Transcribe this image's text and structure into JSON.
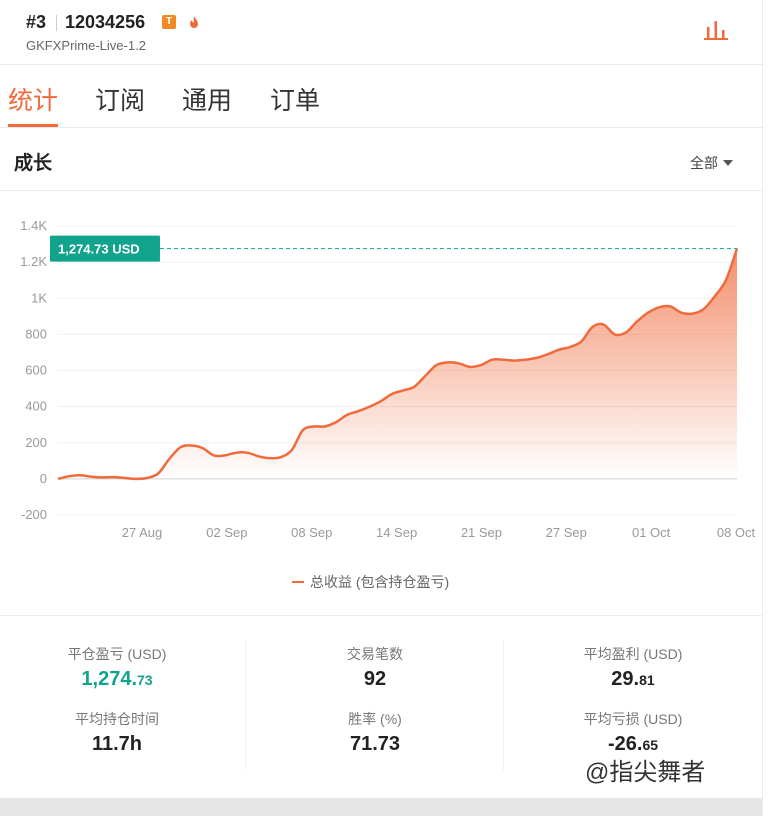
{
  "header": {
    "rank": "#3",
    "account": "12034256",
    "badge": "T",
    "server": "GKFXPrime-Live-1.2"
  },
  "tabs": [
    {
      "label": "统计",
      "active": true
    },
    {
      "label": "订阅",
      "active": false
    },
    {
      "label": "通用",
      "active": false
    },
    {
      "label": "订单",
      "active": false
    }
  ],
  "section": {
    "title": "成长",
    "range": "全部"
  },
  "colors": {
    "accent": "#f06a3c",
    "green": "#12a38d"
  },
  "chart_data": {
    "type": "area",
    "title": "",
    "legend": "总收益 (包含持仓盈亏)",
    "current_label": "1,274.73 USD",
    "current_value": 1274.73,
    "ylim": [
      -200,
      1400
    ],
    "yticks": [
      "1.4K",
      "1.2K",
      "1K",
      "800",
      "600",
      "400",
      "200",
      "0",
      "-200"
    ],
    "ytick_values": [
      1400,
      1200,
      1000,
      800,
      600,
      400,
      200,
      0,
      -200
    ],
    "xticks": [
      "27 Aug",
      "02 Sep",
      "08 Sep",
      "14 Sep",
      "21 Sep",
      "27 Sep",
      "01 Oct",
      "08 Oct"
    ],
    "series": [
      {
        "values": [
          0,
          15,
          20,
          12,
          8,
          10,
          5,
          0,
          5,
          30,
          110,
          175,
          185,
          170,
          130,
          130,
          145,
          145,
          125,
          115,
          120,
          160,
          270,
          290,
          290,
          315,
          355,
          375,
          400,
          430,
          470,
          490,
          510,
          570,
          630,
          645,
          640,
          620,
          630,
          660,
          660,
          655,
          660,
          670,
          690,
          715,
          730,
          760,
          840,
          855,
          800,
          810,
          870,
          920,
          950,
          955,
          920,
          915,
          940,
          1010,
          1100,
          1274.73
        ]
      }
    ]
  },
  "stats": [
    {
      "label": "平仓盈亏 (USD)",
      "value_main": "1,274.",
      "value_small": "73",
      "green": true
    },
    {
      "label": "交易笔数",
      "value_main": "92",
      "value_small": ""
    },
    {
      "label": "平均盈利 (USD)",
      "value_main": "29.",
      "value_small": "81"
    },
    {
      "label": "平均持仓时间",
      "value_main": "11.7h",
      "value_small": ""
    },
    {
      "label": "胜率 (%)",
      "value_main": "71.73",
      "value_small": ""
    },
    {
      "label": "平均亏损 (USD)",
      "value_main": "-26.",
      "value_small": "65"
    }
  ],
  "watermark": "@指尖舞者"
}
